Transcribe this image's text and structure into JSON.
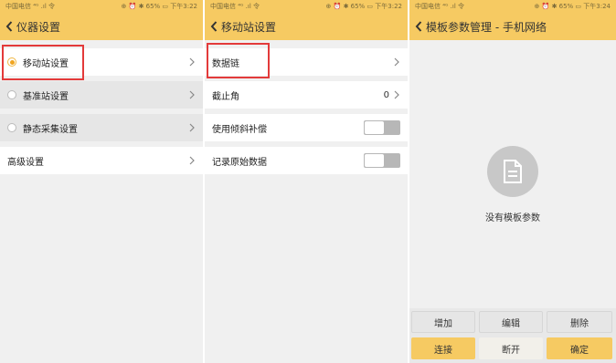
{
  "colors": {
    "accent": "#f6ca62",
    "highlight": "#e33a3a"
  },
  "status": [
    {
      "left": "中国电信 ⁴ᴳ .ıl 令",
      "right": "⊕ ⏰ ✱ 65% ▭ 下午3:22"
    },
    {
      "left": "中国电信 ⁴ᴳ .ıl 令",
      "right": "⊕ ⏰ ✱ 65% ▭ 下午3:22"
    },
    {
      "left": "中国电信 ⁴ᴳ .ıl 令",
      "right": "⊕ ⏰ ✱ 65% ▭ 下午3:24"
    }
  ],
  "panel1": {
    "title": "仪器设置",
    "items": [
      {
        "label": "移动站设置",
        "radio": "on"
      },
      {
        "label": "基准站设置",
        "radio": "off"
      },
      {
        "label": "静态采集设置",
        "radio": "off"
      },
      {
        "label": "高级设置"
      }
    ]
  },
  "panel2": {
    "title": "移动站设置",
    "items": [
      {
        "label": "数据链"
      },
      {
        "label": "截止角",
        "value": "0"
      },
      {
        "label": "使用倾斜补偿",
        "toggle": "off"
      },
      {
        "label": "记录原始数据",
        "toggle": "off"
      }
    ]
  },
  "panel3": {
    "title": "模板参数管理 - 手机网络",
    "empty_icon": "document-icon",
    "empty_text": "没有模板参数",
    "buttons": {
      "add": "增加",
      "edit": "编辑",
      "delete": "删除",
      "connect": "连接",
      "disconnect": "断开",
      "confirm": "确定"
    }
  }
}
